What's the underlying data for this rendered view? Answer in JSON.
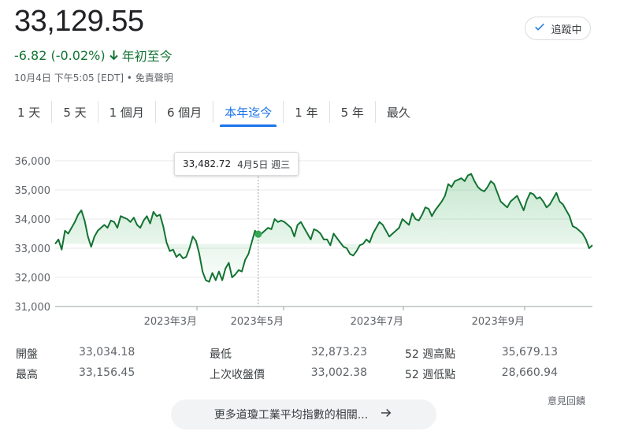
{
  "price": "33,129.55",
  "follow_label": "追蹤中",
  "change": {
    "text": "-6.82 (-0.02%)",
    "period": "年初至今",
    "color": "#137333"
  },
  "meta": "10月4日 下午5:05 [EDT] • 免責聲明",
  "tabs": [
    {
      "label": "1 天",
      "active": false
    },
    {
      "label": "5 天",
      "active": false
    },
    {
      "label": "1 個月",
      "active": false
    },
    {
      "label": "6 個月",
      "active": false
    },
    {
      "label": "本年迄今",
      "active": true
    },
    {
      "label": "1 年",
      "active": false
    },
    {
      "label": "5 年",
      "active": false
    },
    {
      "label": "最久",
      "active": false
    }
  ],
  "tooltip": {
    "value": "33,482.72",
    "date": "4月5日 週三"
  },
  "chart_data": {
    "type": "area",
    "x_ticks": [
      "2023年3月",
      "2023年5月",
      "2023年7月",
      "2023年9月"
    ],
    "y_ticks": [
      "31,000",
      "32,000",
      "33,000",
      "34,000",
      "35,000",
      "36,000"
    ],
    "ylim": [
      31000,
      36000
    ],
    "grid": true,
    "baseline": 33147,
    "color": "#137333",
    "highlight_index": 62,
    "values": [
      33150,
      33300,
      32950,
      33600,
      33500,
      33700,
      33900,
      34150,
      34300,
      33950,
      33400,
      33050,
      33400,
      33600,
      33700,
      33800,
      33700,
      33950,
      33900,
      33700,
      34100,
      34050,
      34000,
      33900,
      34050,
      33800,
      33700,
      33950,
      34100,
      33850,
      34250,
      34100,
      34150,
      33750,
      33200,
      32900,
      32950,
      32700,
      32800,
      32650,
      32700,
      33000,
      33400,
      33250,
      32800,
      32200,
      31900,
      31850,
      32150,
      31900,
      32200,
      31900,
      32300,
      32500,
      32000,
      32100,
      32250,
      32200,
      32600,
      32800,
      33200,
      33600,
      33482,
      33500,
      33600,
      33700,
      33650,
      34000,
      33900,
      33950,
      33900,
      33800,
      33700,
      33400,
      33800,
      33900,
      33700,
      33500,
      33300,
      33650,
      33600,
      33500,
      33300,
      33300,
      33100,
      33500,
      33350,
      33200,
      33050,
      33000,
      32800,
      32750,
      32900,
      33100,
      33150,
      33300,
      33200,
      33500,
      33700,
      33900,
      33800,
      33600,
      33400,
      33500,
      33600,
      33700,
      34000,
      33900,
      33800,
      34200,
      34000,
      33950,
      34150,
      34400,
      34350,
      34100,
      34300,
      34450,
      34600,
      34800,
      35200,
      35100,
      35300,
      35350,
      35400,
      35300,
      35500,
      35550,
      35300,
      35100,
      35000,
      34950,
      35100,
      35300,
      35200,
      34900,
      34600,
      34500,
      34400,
      34600,
      34700,
      34800,
      34550,
      34300,
      34650,
      34900,
      34850,
      34700,
      34750,
      34600,
      34400,
      34500,
      34700,
      34900,
      34600,
      34500,
      34300,
      34100,
      33750,
      33700,
      33600,
      33500,
      33300,
      33000,
      33100
    ]
  },
  "stats": [
    [
      {
        "label": "開盤",
        "value": "33,034.18"
      },
      {
        "label": "最低",
        "value": "32,873.23"
      },
      {
        "label": "52 週高點",
        "value": "35,679.13"
      }
    ],
    [
      {
        "label": "最高",
        "value": "33,156.45"
      },
      {
        "label": "上次收盤價",
        "value": "33,002.38"
      },
      {
        "label": "52 週低點",
        "value": "28,660.94"
      }
    ]
  ],
  "feedback": "意見回饋",
  "more_label": "更多道瓊工業平均指數的相關...",
  "icons": {
    "follow": "check-icon",
    "change": "arrow-down-icon",
    "more": "arrow-right-icon"
  }
}
